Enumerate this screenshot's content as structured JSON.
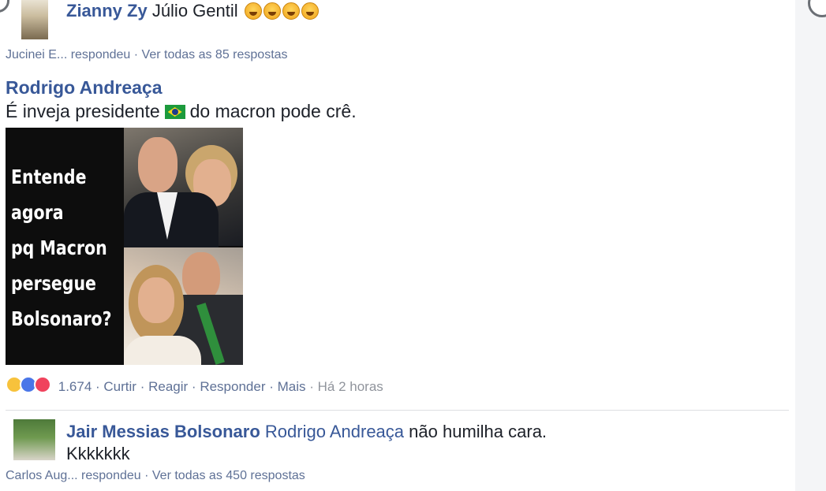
{
  "comment1": {
    "author": "Zianny Zy",
    "tagged": "Júlio Gentil",
    "reply_summary": "Jucinei E... respondeu · Ver todas as 85 respostas"
  },
  "comment2": {
    "author": "Rodrigo Andreaça",
    "text_before": "É inveja presidente",
    "text_after": "do macron pode crê.",
    "meme_lines": [
      "Entende",
      "agora",
      "pq Macron",
      "persegue",
      "Bolsonaro?"
    ],
    "reaction_count": "1.674",
    "actions": [
      "Curtir",
      "Reagir",
      "Responder",
      "Mais"
    ],
    "timestamp": "Há 2 horas"
  },
  "reply": {
    "author": "Jair Messias Bolsonaro",
    "tagged": "Rodrigo Andreaça",
    "text": "não humilha cara.",
    "text2": "Kkkkkkk",
    "reply_summary": "Carlos Aug... respondeu · Ver todas as 450 respostas"
  }
}
